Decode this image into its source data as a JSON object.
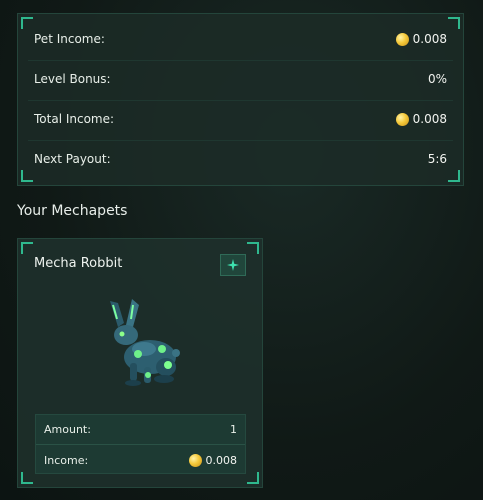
{
  "income_panel": {
    "rows": [
      {
        "label": "Pet Income:",
        "value": "0.008",
        "has_coin": true
      },
      {
        "label": "Level Bonus:",
        "value": "0%",
        "has_coin": false
      },
      {
        "label": "Total Income:",
        "value": "0.008",
        "has_coin": true
      },
      {
        "label": "Next Payout:",
        "value": "5:6",
        "has_coin": false
      }
    ]
  },
  "section_title": "Your Mechapets",
  "pet_card": {
    "name": "Mecha Robbit",
    "badge_icon": "sparkle-icon",
    "amount_label": "Amount:",
    "amount_value": "1",
    "income_label": "Income:",
    "income_value": "0.008"
  },
  "colors": {
    "accent": "#2fb88e",
    "coin": "#f5c93a",
    "panel_bg": "#1c2c27"
  }
}
